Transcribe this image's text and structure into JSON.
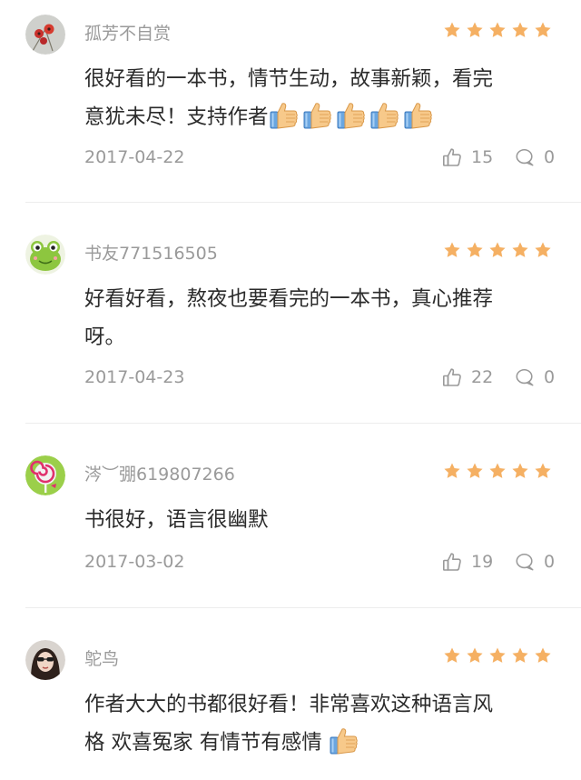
{
  "reviews": [
    {
      "username": "孤芳不自赏",
      "avatar_icon": "red-flower-avatar",
      "rating": 5,
      "line1": "很好看的一本书，情节生动，故事新颖，看完",
      "line2": "意犹未尽！支持作者",
      "emoji_count": 5,
      "date": "2017-04-22",
      "likes": "15",
      "comments": "0"
    },
    {
      "username": "书友771516505",
      "avatar_icon": "green-frog-avatar",
      "rating": 5,
      "line1": "好看好看，熬夜也要看完的一本书，真心推荐",
      "line2": "呀。",
      "date": "2017-04-23",
      "likes": "22",
      "comments": "0"
    },
    {
      "username": "涔︶弸619807266",
      "avatar_icon": "lollipop-avatar",
      "rating": 5,
      "line1": "书很好，语言很幽默",
      "date": "2017-03-02",
      "likes": "19",
      "comments": "0"
    },
    {
      "username": "鸵鸟",
      "avatar_icon": "woman-sunglasses-avatar",
      "rating": 5,
      "line1": "作者大大的书都很好看！非常喜欢这种语言风",
      "line2": "格 欢喜冤家 有情节有感情"
    }
  ],
  "colors": {
    "star": "#f5b063",
    "meta": "#9a9a9a",
    "text": "#2b2b2b",
    "divider": "#ececec"
  },
  "icons": {
    "star": "star-icon",
    "like": "thumbs-up-outline-icon",
    "comment": "speech-bubble-icon",
    "emoji": "thumbs-up-emoji"
  }
}
